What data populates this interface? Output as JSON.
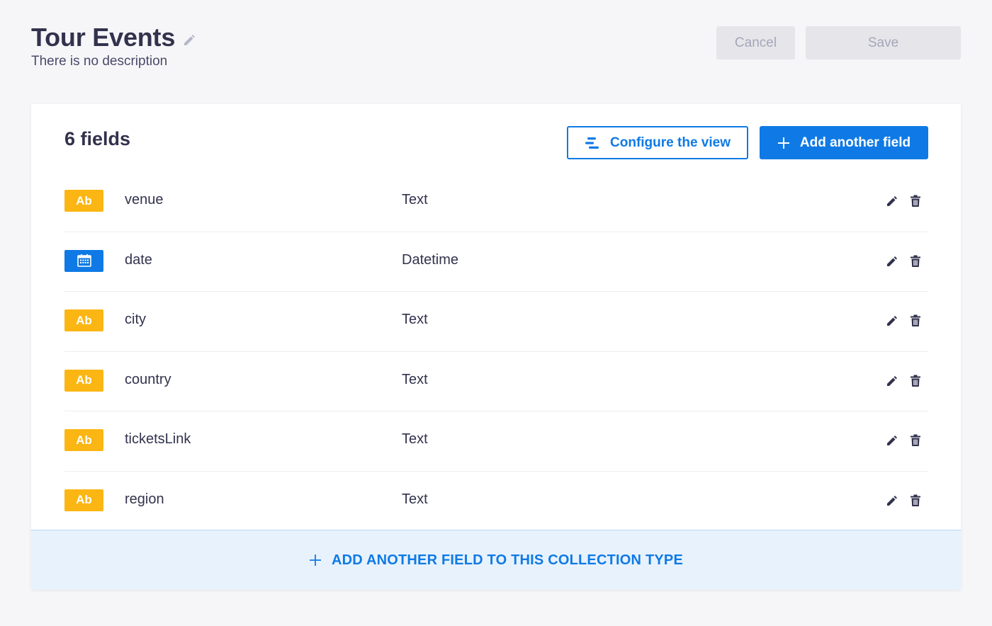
{
  "header": {
    "title": "Tour Events",
    "description": "There is no description",
    "cancel_label": "Cancel",
    "save_label": "Save"
  },
  "card": {
    "field_count_label": "6 fields",
    "configure_label": "Configure the view",
    "add_field_label": "Add another field",
    "add_bar_label": "ADD ANOTHER FIELD TO THIS COLLECTION TYPE"
  },
  "fields": [
    {
      "badge": "Ab",
      "badge_kind": "text",
      "name": "venue",
      "type": "Text"
    },
    {
      "badge": "",
      "badge_kind": "date",
      "name": "date",
      "type": "Datetime"
    },
    {
      "badge": "Ab",
      "badge_kind": "text",
      "name": "city",
      "type": "Text"
    },
    {
      "badge": "Ab",
      "badge_kind": "text",
      "name": "country",
      "type": "Text"
    },
    {
      "badge": "Ab",
      "badge_kind": "text",
      "name": "ticketsLink",
      "type": "Text"
    },
    {
      "badge": "Ab",
      "badge_kind": "text",
      "name": "region",
      "type": "Text"
    }
  ],
  "icons": {
    "title_edit": "pencil-icon",
    "configure": "list-settings-icon",
    "add": "plus-icon",
    "date_badge": "calendar-icon",
    "row_edit": "pencil-icon",
    "row_delete": "trash-icon"
  },
  "colors": {
    "accent": "#0f7ae5",
    "text_badge": "#fbb614",
    "add_bar_bg": "#e8f2fd",
    "disabled_bg": "#e6e6ea",
    "disabled_text": "#a5a5ba"
  }
}
